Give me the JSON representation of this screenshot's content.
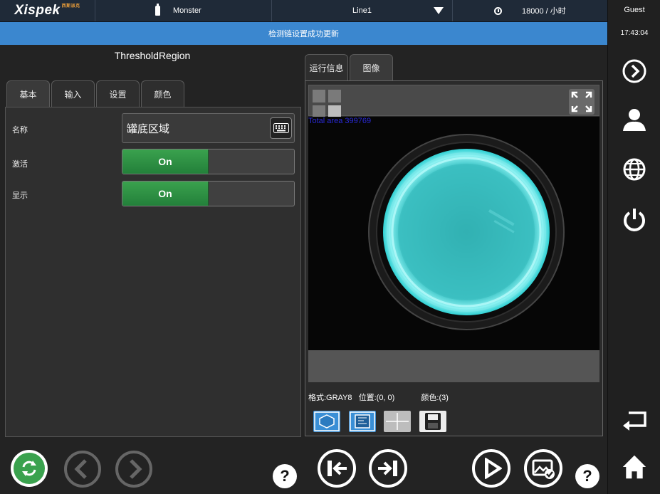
{
  "topbar": {
    "logo": "Xispek",
    "logo_sub": "西斯派克",
    "product": "Monster",
    "line": "Line1",
    "speed": "18000 / 小时"
  },
  "sidebar": {
    "user": "Guest",
    "time": "17:43:04"
  },
  "notification": "检测链设置成功更新",
  "left": {
    "title": "ThresholdRegion",
    "tabs": [
      {
        "label": "基本",
        "active": true
      },
      {
        "label": "输入",
        "active": false
      },
      {
        "label": "设置",
        "active": false
      },
      {
        "label": "颜色",
        "active": false
      }
    ],
    "fields": {
      "name_label": "名称",
      "name_value": "罐底区域",
      "active_label": "激活",
      "active_value": "On",
      "display_label": "显示",
      "display_value": "On"
    }
  },
  "right": {
    "tabs": [
      {
        "label": "运行信息",
        "active": false
      },
      {
        "label": "图像",
        "active": true
      }
    ],
    "area_text": "Total area 399769",
    "format_text": "格式:GRAY8",
    "position_text": "位置:(0, 0)",
    "color_text": "颜色:(3)"
  },
  "bottom": {
    "help_label": "?"
  },
  "colors": {
    "notify_bar": "#3b87cf",
    "toggle_on": "#2e9145",
    "region_cyan": "#3fd8d8"
  }
}
